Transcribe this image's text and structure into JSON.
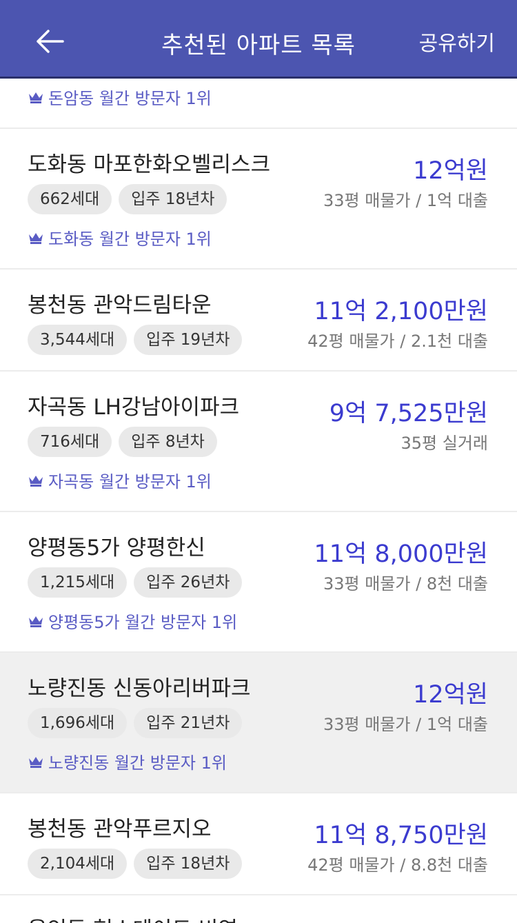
{
  "header": {
    "title": "추천된 아파트 목록",
    "share_label": "공유하기"
  },
  "colors": {
    "appbar": "#4c55b0",
    "price": "#3b3bcf",
    "rank": "#5a5cc4",
    "chip_bg": "#e9e9e9",
    "highlight_bg": "#f0f0f0"
  },
  "list": {
    "top_partial_rank": "돈암동 월간 방문자 1위",
    "items": [
      {
        "name": "도화동 마포한화오벨리스크",
        "households": "662세대",
        "move_in": "입주 18년차",
        "price": "12억원",
        "sub": "33평 매물가 / 1억 대출",
        "rank": "도화동 월간 방문자 1위"
      },
      {
        "name": "봉천동 관악드림타운",
        "households": "3,544세대",
        "move_in": "입주 19년차",
        "price": "11억 2,100만원",
        "sub": "42평 매물가 / 2.1천 대출"
      },
      {
        "name": "자곡동 LH강남아이파크",
        "households": "716세대",
        "move_in": "입주 8년차",
        "price": "9억 7,525만원",
        "sub": "35평 실거래",
        "rank": "자곡동 월간 방문자 1위"
      },
      {
        "name": "양평동5가 양평한신",
        "households": "1,215세대",
        "move_in": "입주 26년차",
        "price": "11억 8,000만원",
        "sub": "33평 매물가 / 8천 대출",
        "rank": "양평동5가 월간 방문자 1위"
      },
      {
        "name": "노량진동 신동아리버파크",
        "households": "1,696세대",
        "move_in": "입주 21년차",
        "price": "12억원",
        "sub": "33평 매물가 / 1억 대출",
        "rank": "노량진동 월간 방문자 1위"
      },
      {
        "name": "봉천동 관악푸르지오",
        "households": "2,104세대",
        "move_in": "입주 18년차",
        "price": "11억 8,750만원",
        "sub": "42평 매물가 / 8.8천 대출"
      }
    ],
    "bottom_partial_name": "용인동 현스테이트 비연"
  }
}
